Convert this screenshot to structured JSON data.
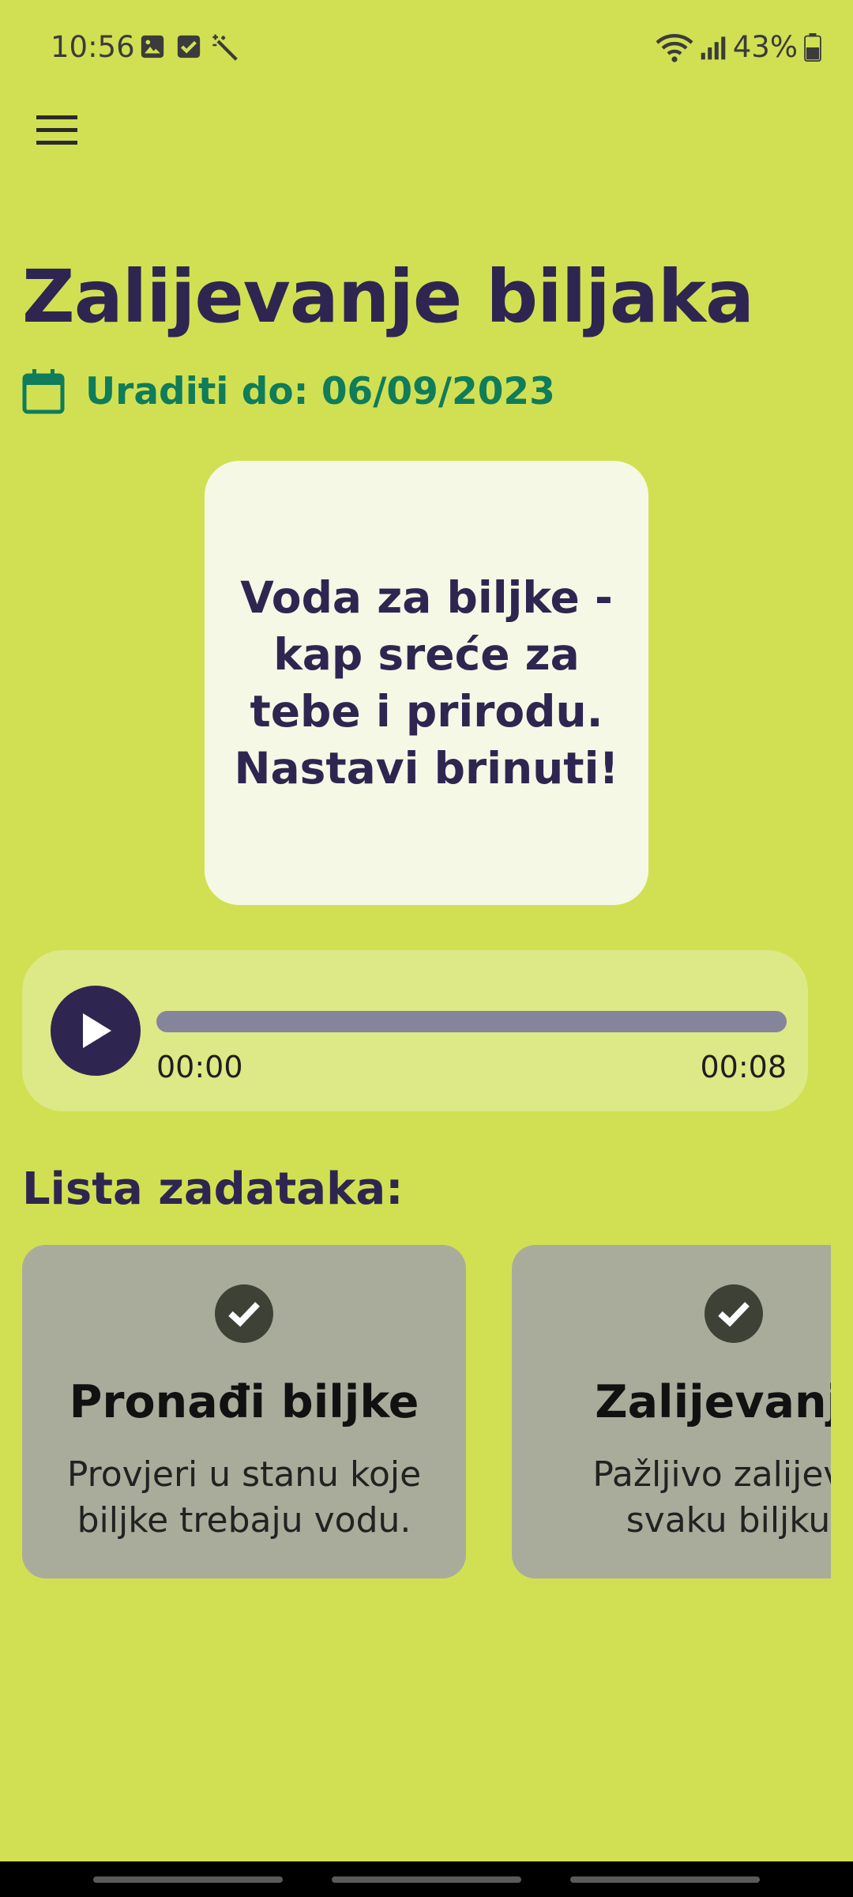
{
  "status_bar": {
    "time": "10:56",
    "battery": "43%",
    "icons": [
      "image-icon",
      "checkbox-icon",
      "magic-wand-icon",
      "wifi-icon",
      "signal-icon",
      "battery-icon"
    ]
  },
  "header": {
    "menu_icon": "hamburger-menu-icon"
  },
  "page": {
    "title": "Zalijevanje biljaka",
    "due_label": "Uraditi do: 06/09/2023",
    "due_icon": "calendar-icon"
  },
  "quote": {
    "text": "Voda za biljke - kap sreće za tebe i prirodu. Nastavi brinuti!"
  },
  "player": {
    "current_time": "00:00",
    "total_time": "00:08",
    "progress": 0
  },
  "tasks": {
    "title": "Lista zadataka:",
    "items": [
      {
        "title": "Pronađi biljke",
        "description": "Provjeri u stanu koje biljke trebaju vodu.",
        "icon": "check-circle-icon"
      },
      {
        "title": "Zalijevanje",
        "description": "Pažljivo zalijevaj svaku biljku.",
        "icon": "check-circle-icon"
      }
    ]
  },
  "colors": {
    "background": "#d1e053",
    "primary": "#2e2650",
    "accent": "#0f7c5a",
    "card": "#f6f8e6",
    "task_card": "#aaac9b"
  }
}
